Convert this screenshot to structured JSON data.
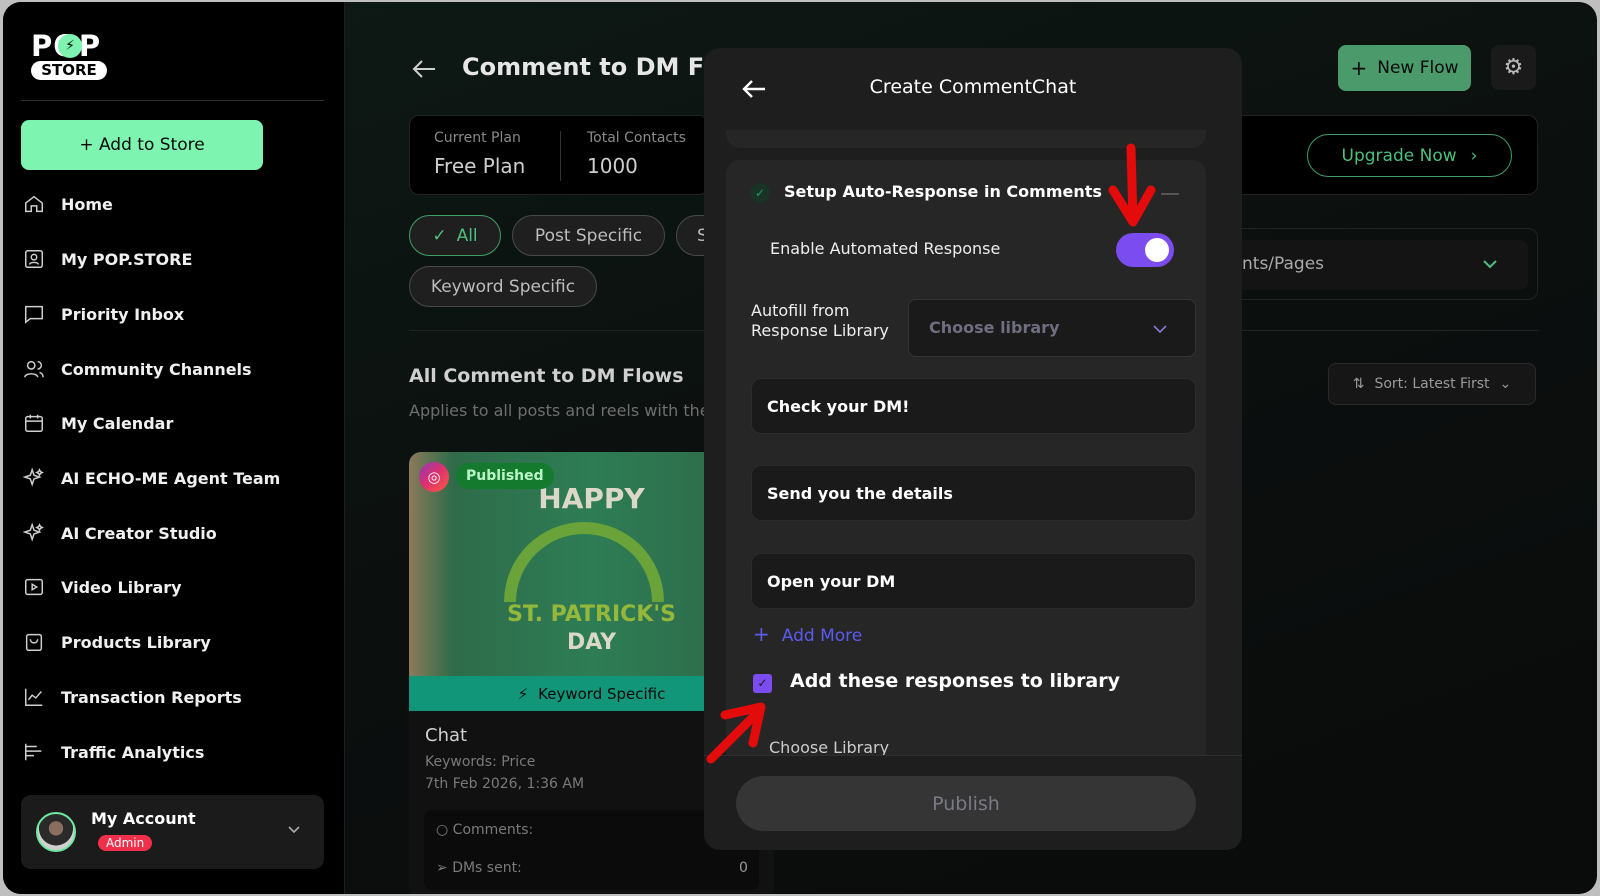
{
  "sidebar": {
    "logo": {
      "top": "POP",
      "bottom": "STORE"
    },
    "add_button": "+ Add to Store",
    "items": [
      {
        "label": "Home",
        "icon": "home-icon"
      },
      {
        "label": "My POP.STORE",
        "icon": "profile-icon"
      },
      {
        "label": "Priority Inbox",
        "icon": "message-icon"
      },
      {
        "label": "Community Channels",
        "icon": "users-icon"
      },
      {
        "label": "My Calendar",
        "icon": "calendar-icon"
      },
      {
        "label": "AI ECHO-ME Agent Team",
        "icon": "sparkle-icon"
      },
      {
        "label": "AI Creator Studio",
        "icon": "sparkle-icon"
      },
      {
        "label": "Video Library",
        "icon": "video-icon"
      },
      {
        "label": "Products Library",
        "icon": "bag-icon"
      },
      {
        "label": "Transaction Reports",
        "icon": "chart-icon"
      },
      {
        "label": "Traffic Analytics",
        "icon": "bars-icon"
      }
    ],
    "account": {
      "name": "My Account",
      "role": "Admin"
    }
  },
  "main": {
    "title": "Comment to DM Flows",
    "plan": {
      "label": "Current Plan",
      "value": "Free Plan"
    },
    "contacts": {
      "label": "Total Contacts",
      "value": "1000"
    },
    "filters": [
      "All",
      "Post Specific",
      "S",
      "Keyword Specific"
    ],
    "section_title": "All Comment to DM Flows",
    "section_subtitle": "Applies to all posts and reels with the",
    "new_flow": "New Flow",
    "upgrade": "Upgrade Now",
    "accounts_dropdown": "nts/Pages",
    "sort": "Sort: Latest First",
    "flow_card": {
      "status": "Published",
      "image_text": {
        "line1": "HAPPY",
        "line2": "ST. PATRICK'S",
        "line3": "DAY"
      },
      "type": "Keyword Specific",
      "name": "Chat",
      "keywords": "Keywords: Price",
      "date": "7th Feb 2026, 1:36 AM",
      "comments_label": "Comments:",
      "dms_label": "DMs sent:",
      "dms_value": "0"
    }
  },
  "modal": {
    "title": "Create CommentChat",
    "section_title": "Setup Auto-Response in Comments",
    "enable_label": "Enable Automated Response",
    "enabled": true,
    "autofill_label_1": "Autofill from",
    "autofill_label_2": "Response Library",
    "library_placeholder": "Choose library",
    "responses": [
      "Check your DM!",
      "Send you the details",
      "Open your DM"
    ],
    "add_more": "Add More",
    "add_to_library_label": "Add these responses to library",
    "add_to_library_checked": true,
    "choose_library_label": "Choose Library",
    "publish": "Publish"
  },
  "colors": {
    "accent_green": "#7df5b0",
    "purple": "#7b4cf0",
    "annotation_red": "#e30b0b"
  }
}
